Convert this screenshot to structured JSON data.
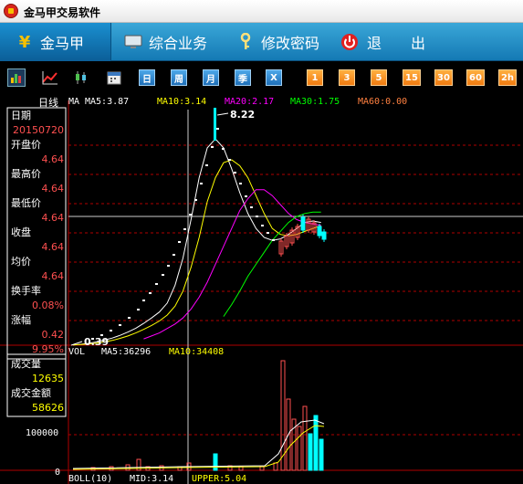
{
  "app": {
    "title": "金马甲交易软件"
  },
  "menu": {
    "items": [
      "金马甲",
      "综合业务",
      "修改密码",
      "退",
      "出"
    ]
  },
  "toolbar": {
    "buttons": [
      "日",
      "周",
      "月",
      "季",
      "X",
      "1",
      "3",
      "5",
      "15",
      "30",
      "60",
      "2h"
    ]
  },
  "chart": {
    "period_label": "日线",
    "ma_labels": [
      {
        "text": "MA",
        "color": "#ffffff"
      },
      {
        "text": "MA5:3.87",
        "color": "#ffffff"
      },
      {
        "text": "MA10:3.14",
        "color": "#ffff00"
      },
      {
        "text": "MA20:2.17",
        "color": "#ff00ff"
      },
      {
        "text": "MA30:1.75",
        "color": "#00ff00"
      },
      {
        "text": "MA60:0.00",
        "color": "#ff8040"
      }
    ],
    "peak_label": "8.22",
    "low_label": "0.39"
  },
  "info": [
    {
      "label": "日期",
      "value": "20150720"
    },
    {
      "label": "开盘价",
      "value": "4.64"
    },
    {
      "label": "最高价",
      "value": "4.64"
    },
    {
      "label": "最低价",
      "value": "4.64"
    },
    {
      "label": "收盘",
      "value": "4.64"
    },
    {
      "label": "均价",
      "value": "4.64"
    },
    {
      "label": "换手率",
      "value": "0.08%"
    },
    {
      "label": "涨幅",
      "value": "0.42"
    },
    {
      "label": "",
      "value": "9.95%"
    },
    {
      "label": "成交量",
      "value": "12635"
    },
    {
      "label": "成交金额",
      "value": "58626"
    }
  ],
  "volume": {
    "header": [
      {
        "text": "VOL",
        "color": "#ffffff"
      },
      {
        "text": "MA5:36296",
        "color": "#ffffff"
      },
      {
        "text": "MA10:34408",
        "color": "#ffff00"
      }
    ],
    "axis_labels": [
      "100000",
      "0"
    ]
  },
  "footer": {
    "items": [
      {
        "text": "BOLL(10)",
        "color": "#ffffff"
      },
      {
        "text": "MID:3.14",
        "color": "#ffffff"
      },
      {
        "text": "UPPER:5.04",
        "color": "#ffff00"
      }
    ]
  },
  "colors": {
    "up": "#ff5050",
    "down": "#00ffff",
    "ma5": "#ffffff",
    "ma10": "#ffff00",
    "ma20": "#ff00ff",
    "ma30": "#00ff00",
    "grid": "#c00000",
    "menu_bg": "#1e8fcf"
  },
  "price_series": {
    "ma5": [
      0.4,
      0.42,
      0.45,
      0.5,
      0.56,
      0.63,
      0.72,
      0.83,
      0.96,
      1.12,
      1.3,
      1.5,
      1.8,
      2.4,
      3.3,
      4.6,
      6.0,
      7.0,
      7.3,
      7.0,
      6.3,
      5.5,
      4.8,
      4.3,
      4.0,
      3.9,
      3.95,
      4.1,
      4.3,
      4.5,
      4.55,
      4.5
    ],
    "ma10": [
      0.4,
      0.41,
      0.43,
      0.46,
      0.5,
      0.55,
      0.62,
      0.7,
      0.8,
      0.92,
      1.05,
      1.2,
      1.4,
      1.7,
      2.2,
      3.0,
      4.0,
      5.2,
      6.0,
      6.5,
      6.6,
      6.4,
      6.0,
      5.4,
      4.8,
      4.3,
      4.1,
      4.05,
      4.1,
      4.2,
      4.3,
      4.4
    ],
    "ma20": [
      null,
      null,
      null,
      null,
      null,
      null,
      null,
      null,
      null,
      0.6,
      0.7,
      0.8,
      0.95,
      1.1,
      1.3,
      1.6,
      2.0,
      2.5,
      3.1,
      3.7,
      4.3,
      4.9,
      5.3,
      5.6,
      5.6,
      5.4,
      5.1,
      4.8,
      4.6,
      4.5,
      4.45,
      4.4
    ],
    "ma30": [
      null,
      null,
      null,
      null,
      null,
      null,
      null,
      null,
      null,
      null,
      null,
      null,
      null,
      null,
      null,
      null,
      null,
      null,
      null,
      1.35,
      1.75,
      2.2,
      2.7,
      3.1,
      3.5,
      3.9,
      4.2,
      4.5,
      4.7,
      4.8,
      4.85,
      4.85
    ]
  }
}
